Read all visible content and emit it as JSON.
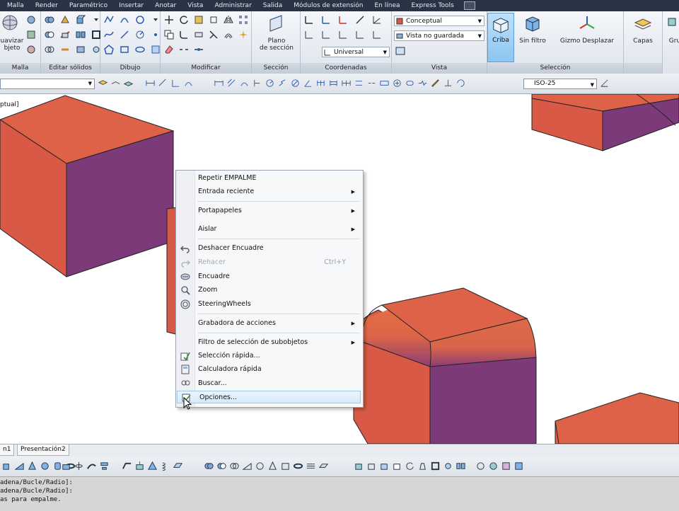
{
  "menubar": {
    "tabs": [
      "Malla",
      "Render",
      "Paramétrico",
      "Insertar",
      "Anotar",
      "Vista",
      "Administrar",
      "Salida",
      "Módulos de extensión",
      "En línea",
      "Express Tools"
    ]
  },
  "ribbon": {
    "panels": {
      "malla": "Malla",
      "editar_solidos": "Editar sólidos",
      "dibujo": "Dibujo",
      "modificar": "Modificar",
      "seccion": "Sección",
      "coordenadas": "Coordenadas",
      "vista": "Vista",
      "seleccion": "Selección"
    },
    "suavizar_label_1": "uavizar",
    "suavizar_label_2": "bjeto",
    "plano_seccion_1": "Plano",
    "plano_seccion_2": "de sección",
    "coord_combo": "Universal",
    "visual_style_combo": "Conceptual",
    "named_view_combo": "Vista no guardada",
    "criba_label": "Criba",
    "sin_filtro_label": "Sin filtro",
    "gizmo_label": "Gizmo Desplazar",
    "capas_label": "Capas",
    "gru_label": "Gru"
  },
  "toolbar2": {
    "dimstyle": "ISO-25"
  },
  "viewport": {
    "label": "ptual]"
  },
  "context_menu": {
    "items": [
      {
        "label": "Repetir EMPALME",
        "shortcut": "",
        "submenu": false,
        "icon": "",
        "disabled": false
      },
      {
        "label": "Entrada reciente",
        "shortcut": "",
        "submenu": true,
        "icon": "",
        "disabled": false
      },
      {
        "label": "Portapapeles",
        "shortcut": "",
        "submenu": true,
        "icon": "",
        "disabled": false
      },
      {
        "label": "Aislar",
        "shortcut": "",
        "submenu": true,
        "icon": "",
        "disabled": false
      },
      {
        "label": "Deshacer Encuadre",
        "shortcut": "",
        "submenu": false,
        "icon": "undo-icon",
        "disabled": false
      },
      {
        "label": "Rehacer",
        "shortcut": "Ctrl+Y",
        "submenu": false,
        "icon": "redo-icon",
        "disabled": true
      },
      {
        "label": "Encuadre",
        "shortcut": "",
        "submenu": false,
        "icon": "pan-icon",
        "disabled": false
      },
      {
        "label": "Zoom",
        "shortcut": "",
        "submenu": false,
        "icon": "zoom-icon",
        "disabled": false
      },
      {
        "label": "SteeringWheels",
        "shortcut": "",
        "submenu": false,
        "icon": "steering-wheel-icon",
        "disabled": false
      },
      {
        "label": "Grabadora de acciones",
        "shortcut": "",
        "submenu": true,
        "icon": "",
        "disabled": false
      },
      {
        "label": "Filtro de selección de subobjetos",
        "shortcut": "",
        "submenu": true,
        "icon": "",
        "disabled": false
      },
      {
        "label": "Selección rápida...",
        "shortcut": "",
        "submenu": false,
        "icon": "quick-select-icon",
        "disabled": false
      },
      {
        "label": "Calculadora rápida",
        "shortcut": "",
        "submenu": false,
        "icon": "calculator-icon",
        "disabled": false
      },
      {
        "label": "Buscar...",
        "shortcut": "",
        "submenu": false,
        "icon": "find-icon",
        "disabled": false
      },
      {
        "label": "Opciones...",
        "shortcut": "",
        "submenu": false,
        "icon": "options-icon",
        "disabled": false,
        "highlighted": true
      }
    ]
  },
  "layout_tabs": [
    "n1",
    "Presentación2"
  ],
  "command_line": {
    "lines": [
      "adena/Bucle/Radio]:",
      "adena/Bucle/Radio]:",
      "as para empalme."
    ]
  },
  "colors": {
    "cube_top": "#dd6247",
    "cube_side_left": "#d85a46",
    "cube_side_right": "#7c3a78",
    "menu_highlight": "#d6e9fa",
    "menubar_bg": "#2a3344"
  }
}
